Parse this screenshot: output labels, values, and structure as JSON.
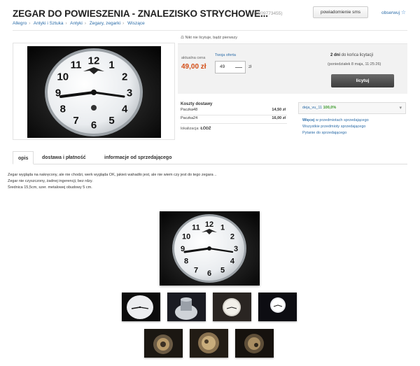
{
  "header": {
    "title": "ZEGAR DO POWIESZENIA - ZNALEZISKO STRYCHOWE...",
    "item_id": "(6809773455)",
    "sms_button": "powiadomienie sms",
    "watch_link": "obserwuj",
    "watch_icon": "star-icon"
  },
  "breadcrumb": [
    "Allegro",
    "Antyki i Sztuka",
    "Antyki",
    "Zegary, zegarki",
    "Wiszące"
  ],
  "auction": {
    "bids_note": "Nikt nie licytuje, bądź pierwszy",
    "current_price_label": "aktualna cena",
    "current_price": "49,00 zł",
    "offer_label": "Twoja oferta",
    "offer_value": "49",
    "currency": "zł",
    "days_left_bold": "2 dni",
    "days_left_rest": " do końca licytacji",
    "end_date": "(poniedziałek 8 maja, 11:25:26)",
    "bid_button": "licytuj"
  },
  "shipping": {
    "title": "Koszty dostawy",
    "rows": [
      {
        "method": "Paczka48",
        "price": "14,50 zł"
      },
      {
        "method": "Paczka24",
        "price": "16,00 zł"
      }
    ],
    "location_label": "lokalizacja:",
    "location_value": "ŁÓDŹ"
  },
  "seller": {
    "name": "deja_vu_11",
    "rating": "100,0%",
    "links": {
      "items_strong": "Więcej",
      "items_rest": " w przedmiotach sprzedającego",
      "all_items": "Wszystkie przedmioty sprzedającego",
      "ask": "Pytanie do sprzedającego"
    }
  },
  "tabs": [
    "opis",
    "dostawa i płatność",
    "informacje od sprzedającego"
  ],
  "description": [
    "Zegar wygląda na nakręcony, ale nie chodzi, werk wygląda OK, jakieś wahadło jest, ale nie wiem czy jest do tego zegara ..",
    "Zegar nie czyszczony, żadnej ingerencji, bez rdzy.",
    "Średnica 15,5cm, szer. metalowej obudowy 5 cm."
  ],
  "clock_numerals": [
    "12",
    "1",
    "2",
    "3",
    "4",
    "5",
    "6",
    "7",
    "8",
    "9",
    "10",
    "11"
  ],
  "colors": {
    "price": "#d34d16",
    "link": "#2b6ca8",
    "rating": "#3a9a2a"
  }
}
